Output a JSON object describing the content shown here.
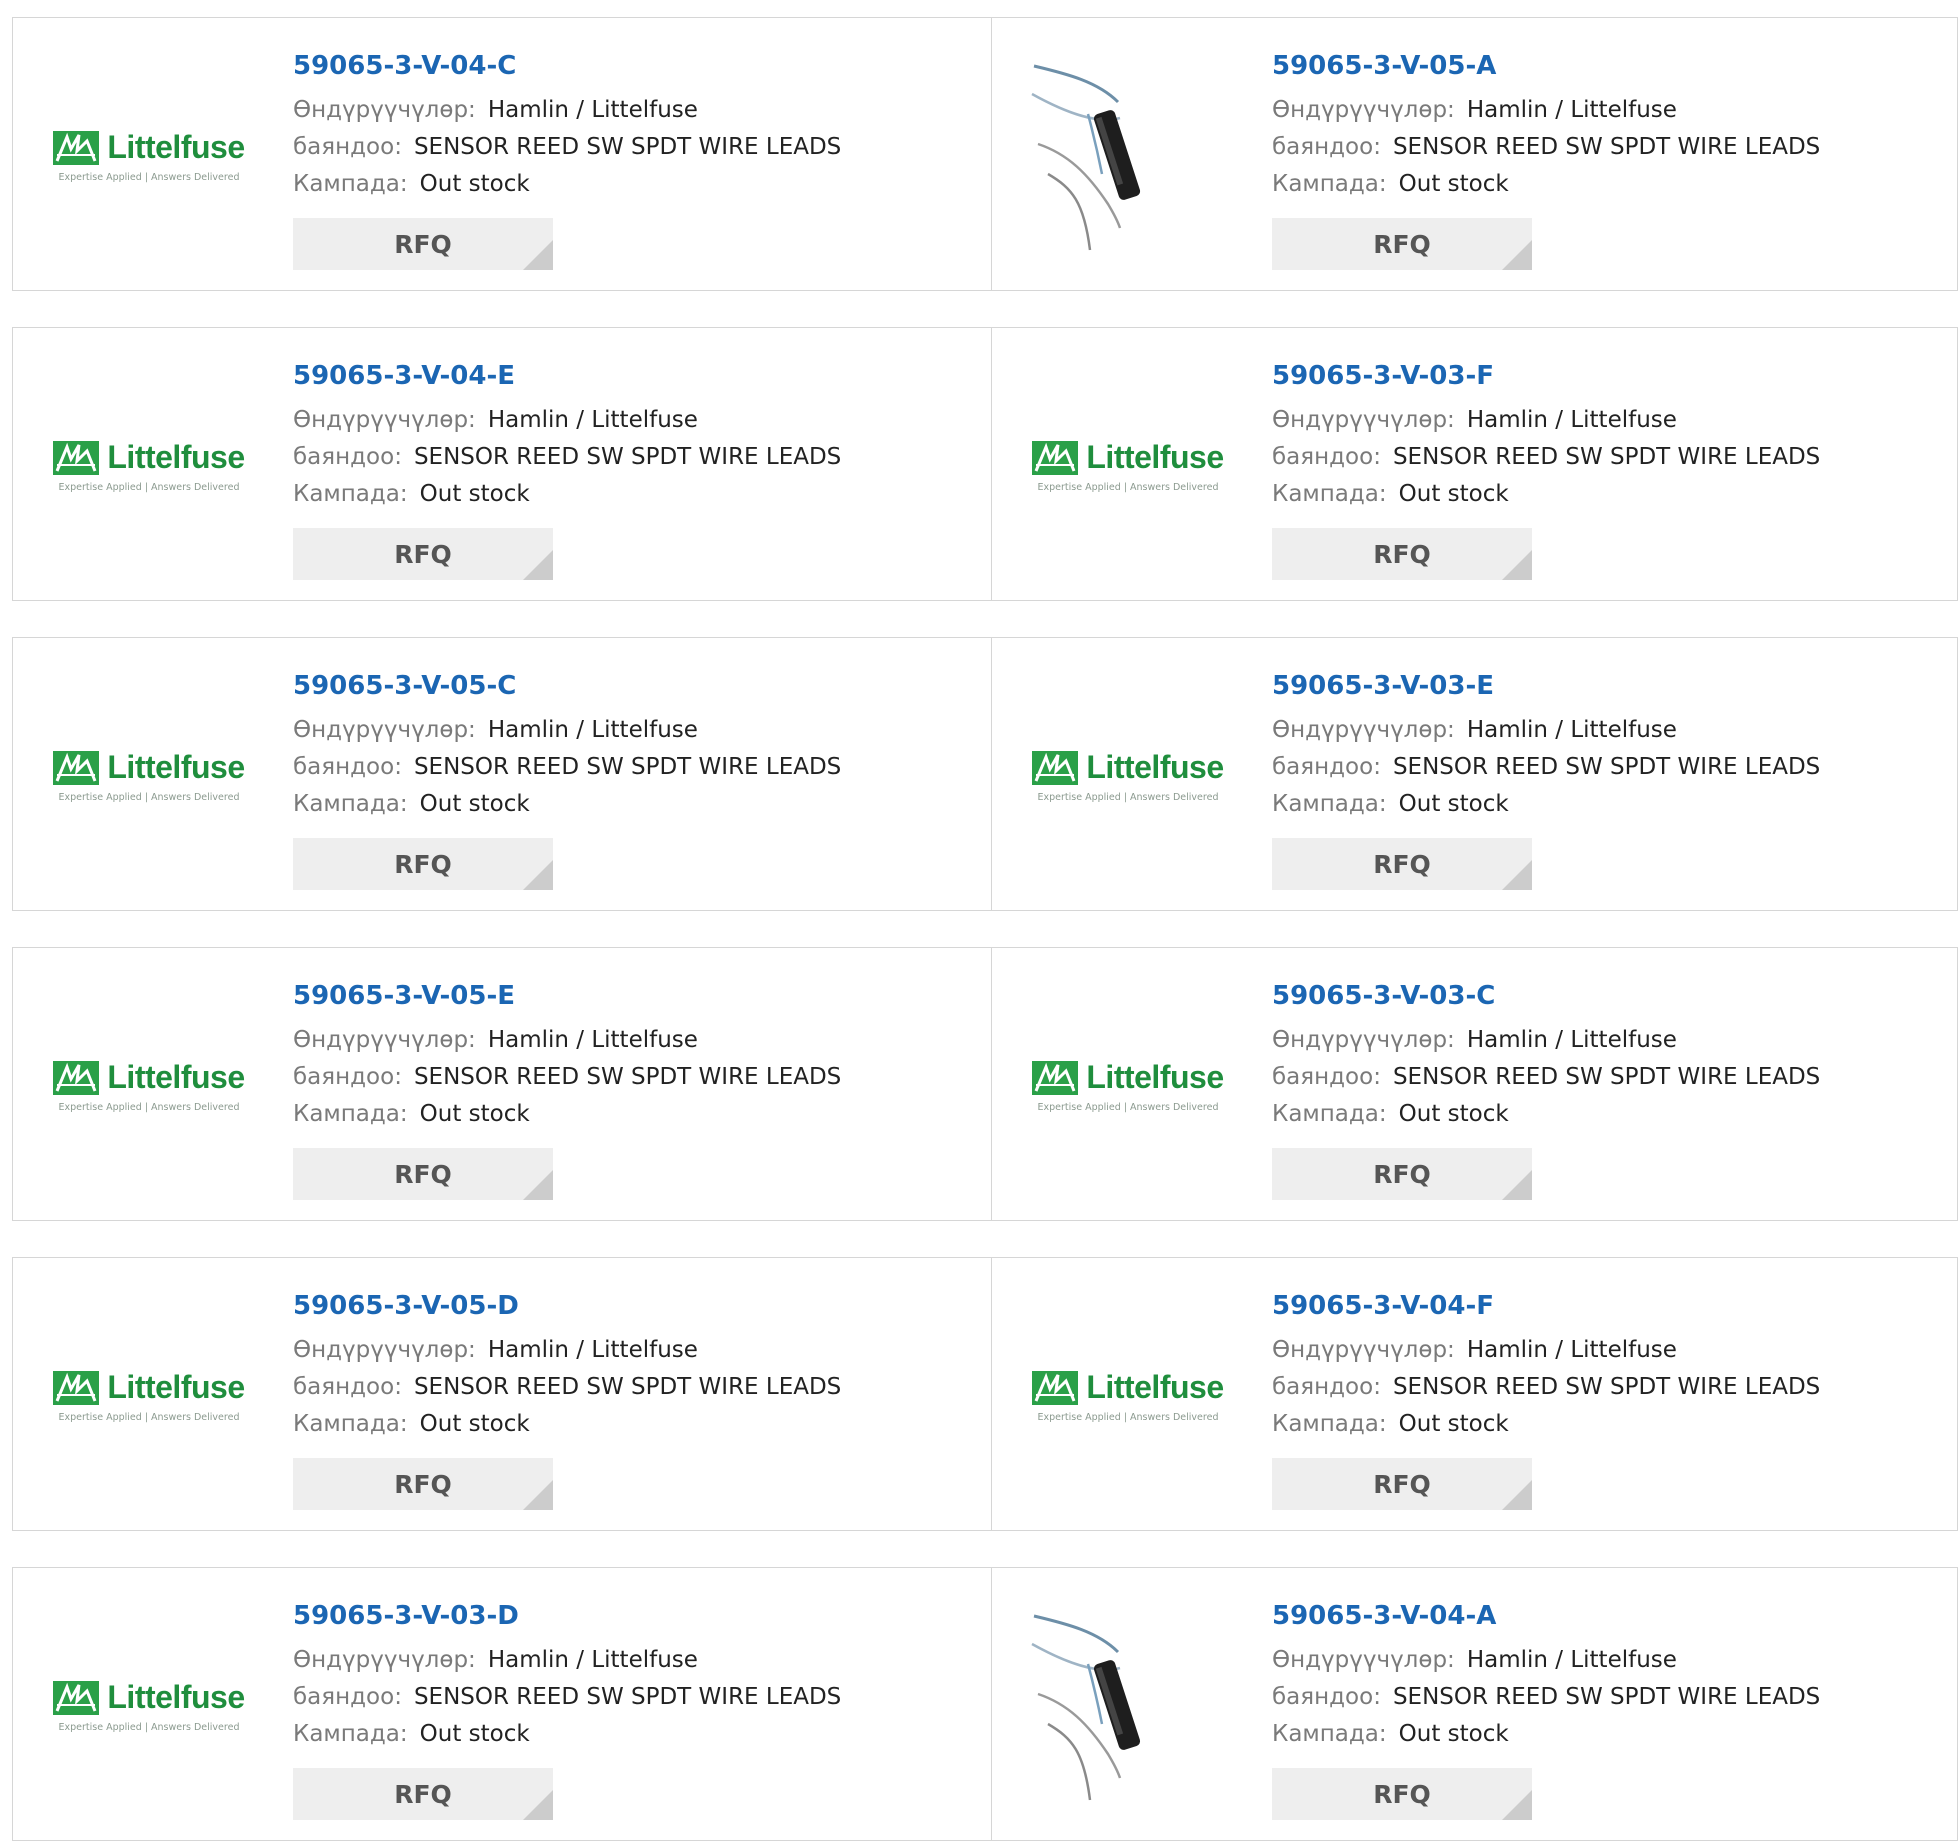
{
  "labels": {
    "manufacturer": "Өндүрүүчүлөр:",
    "description": "баяндоо:",
    "stock": "Кампада:",
    "rfq": "RFQ"
  },
  "logo": {
    "wordmark": "Littelfuse",
    "tagline": "Expertise Applied | Answers Delivered",
    "color": "#1f8e3d"
  },
  "products": [
    {
      "part": "59065-3-V-04-C",
      "manufacturer": "Hamlin / Littelfuse",
      "description": "SENSOR REED SW SPDT WIRE LEADS",
      "stock": "Out stock",
      "image": "logo"
    },
    {
      "part": "59065-3-V-05-A",
      "manufacturer": "Hamlin / Littelfuse",
      "description": "SENSOR REED SW SPDT WIRE LEADS",
      "stock": "Out stock",
      "image": "sensor-photo"
    },
    {
      "part": "59065-3-V-04-E",
      "manufacturer": "Hamlin / Littelfuse",
      "description": "SENSOR REED SW SPDT WIRE LEADS",
      "stock": "Out stock",
      "image": "logo"
    },
    {
      "part": "59065-3-V-03-F",
      "manufacturer": "Hamlin / Littelfuse",
      "description": "SENSOR REED SW SPDT WIRE LEADS",
      "stock": "Out stock",
      "image": "logo"
    },
    {
      "part": "59065-3-V-05-C",
      "manufacturer": "Hamlin / Littelfuse",
      "description": "SENSOR REED SW SPDT WIRE LEADS",
      "stock": "Out stock",
      "image": "logo"
    },
    {
      "part": "59065-3-V-03-E",
      "manufacturer": "Hamlin / Littelfuse",
      "description": "SENSOR REED SW SPDT WIRE LEADS",
      "stock": "Out stock",
      "image": "logo"
    },
    {
      "part": "59065-3-V-05-E",
      "manufacturer": "Hamlin / Littelfuse",
      "description": "SENSOR REED SW SPDT WIRE LEADS",
      "stock": "Out stock",
      "image": "logo"
    },
    {
      "part": "59065-3-V-03-C",
      "manufacturer": "Hamlin / Littelfuse",
      "description": "SENSOR REED SW SPDT WIRE LEADS",
      "stock": "Out stock",
      "image": "logo"
    },
    {
      "part": "59065-3-V-05-D",
      "manufacturer": "Hamlin / Littelfuse",
      "description": "SENSOR REED SW SPDT WIRE LEADS",
      "stock": "Out stock",
      "image": "logo"
    },
    {
      "part": "59065-3-V-04-F",
      "manufacturer": "Hamlin / Littelfuse",
      "description": "SENSOR REED SW SPDT WIRE LEADS",
      "stock": "Out stock",
      "image": "logo"
    },
    {
      "part": "59065-3-V-03-D",
      "manufacturer": "Hamlin / Littelfuse",
      "description": "SENSOR REED SW SPDT WIRE LEADS",
      "stock": "Out stock",
      "image": "logo"
    },
    {
      "part": "59065-3-V-04-A",
      "manufacturer": "Hamlin / Littelfuse",
      "description": "SENSOR REED SW SPDT WIRE LEADS",
      "stock": "Out stock",
      "image": "sensor-photo"
    }
  ]
}
